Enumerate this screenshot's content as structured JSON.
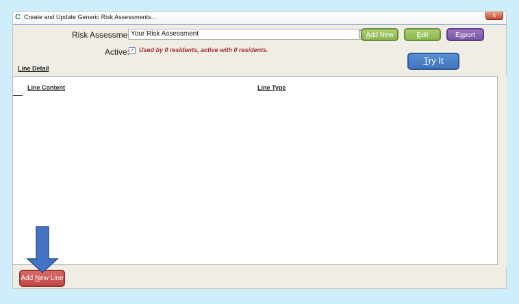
{
  "window": {
    "title": "Create and Update Generic Risk Assessments...",
    "logo_letter": "C",
    "close_symbol": "x"
  },
  "form": {
    "risk_assessment_label": "Risk Assessment:",
    "risk_assessment_value": "Your Risk Assessment",
    "active_label": "Active:",
    "active_checked": true,
    "usage_text": "Used by 0 residents, active with 0 residents.",
    "line_detail_label": "Line Detail"
  },
  "buttons": {
    "add_new": {
      "prefix": "",
      "accel": "A",
      "suffix": "dd New"
    },
    "edit": {
      "prefix": "",
      "accel": "E",
      "suffix": "dit"
    },
    "export": {
      "prefix": "E",
      "accel": "x",
      "suffix": "port"
    },
    "try_it": {
      "prefix": "",
      "accel": "T",
      "suffix": "ry It"
    },
    "add_new_line": {
      "prefix": "Add ",
      "accel": "N",
      "suffix": "ew Line"
    }
  },
  "table": {
    "columns": [
      "Line Content",
      "Line Type"
    ],
    "rows": []
  },
  "colors": {
    "background": "#cfeefc",
    "window": "#f0eee4",
    "green_button": "#8ab84e",
    "purple_button": "#7c56a8",
    "blue_button": "#4074bc",
    "red_button": "#c24a46",
    "arrow": "#4472c4",
    "usage_text": "#a02c2c"
  },
  "icons": [
    "dropdown-arrow-icon",
    "checkmark-icon",
    "down-arrow-icon",
    "app-logo-icon"
  ]
}
